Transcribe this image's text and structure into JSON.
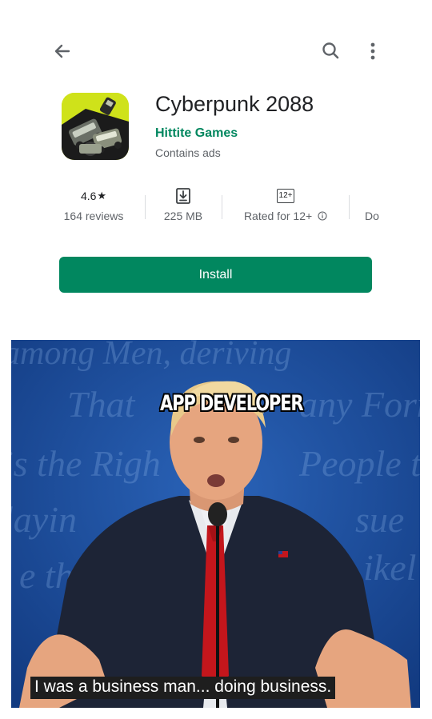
{
  "appbar": {
    "back_icon": "arrow-left-icon",
    "search_icon": "search-icon",
    "more_icon": "more-vert-icon"
  },
  "app": {
    "icon": "game-app-icon",
    "title": "Cyberpunk 2088",
    "developer": "Hittite Games",
    "ads_notice": "Contains ads"
  },
  "stats": {
    "rating_value": "4.6",
    "rating_star": "★",
    "reviews": "164 reviews",
    "size_icon": "download-icon",
    "size": "225 MB",
    "age_badge": "12+",
    "age_text": "Rated for 12+",
    "age_info_icon": "info-icon",
    "partial": "Do"
  },
  "install": {
    "label": "Install"
  },
  "meme": {
    "top_label": "APP DEVELOPER",
    "caption": "I was a business man... doing business."
  },
  "colors": {
    "accent": "#01875f",
    "text_primary": "#202124",
    "text_secondary": "#5f6368",
    "meme_background": "#1a4a9a"
  }
}
